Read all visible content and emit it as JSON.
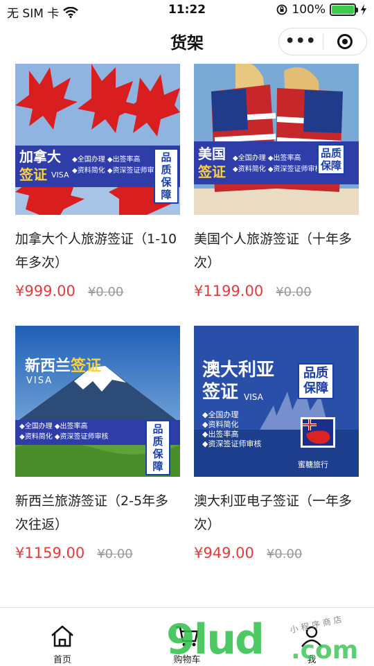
{
  "status": {
    "carrier": "无 SIM 卡",
    "time": "11:22",
    "battery": "100%",
    "battery_level": 1.0
  },
  "nav": {
    "title": "货架",
    "more": "•••"
  },
  "products": [
    {
      "name": "加拿大个人旅游签证（1-10年多次）",
      "price": "¥999.00",
      "original_price": "¥0.00",
      "banner_title1": "加拿大",
      "banner_title2": "签证",
      "banner_visa": "VISA",
      "banner_lines": [
        "◆全国办理 ◆出签率高",
        "◆资料简化 ◆资深签证师审核"
      ],
      "badge": [
        "品质",
        "保障"
      ]
    },
    {
      "name": "美国个人旅游签证（十年多次）",
      "price": "¥1199.00",
      "original_price": "¥0.00",
      "banner_title1": "美国",
      "banner_title2": "签证",
      "banner_visa": "VISA",
      "banner_lines": [
        "◆全国办理 ◆出签率高",
        "◆资料简化 ◆资深签证师审核"
      ],
      "badge": [
        "品质",
        "保障"
      ]
    },
    {
      "name": "新西兰旅游签证（2-5年多次往返）",
      "price": "¥1159.00",
      "original_price": "¥0.00",
      "banner_title1": "新西兰",
      "banner_title2": "签证",
      "banner_visa": "VISA",
      "banner_lines": [
        "◆全国办理 ◆出签率高",
        "◆资料简化 ◆资深签证师审核"
      ],
      "badge": [
        "品质",
        "保障"
      ]
    },
    {
      "name": "澳大利亚电子签证（一年多次）",
      "price": "¥949.00",
      "original_price": "¥0.00",
      "banner_title1": "澳大利亚",
      "banner_title2": "签证",
      "banner_visa": "VISA",
      "banner_lines": [
        "◆全国办理",
        "◆资料简化",
        "◆出签率高",
        "◆资深签证师审核"
      ],
      "badge": [
        "品质",
        "保障"
      ],
      "brand": "蜜糖旅行"
    }
  ],
  "tabbar": {
    "items": [
      {
        "label": "首页",
        "icon": "home-icon"
      },
      {
        "label": "购物车",
        "icon": "cart-icon"
      },
      {
        "label": "我",
        "icon": "profile-icon"
      }
    ]
  },
  "watermark": {
    "main": "9lud",
    "suffix": ".com",
    "small": "小程序商店"
  },
  "colors": {
    "price": "#e23b3b",
    "banner": "#2e3da8",
    "accent_green": "#35c24e"
  }
}
